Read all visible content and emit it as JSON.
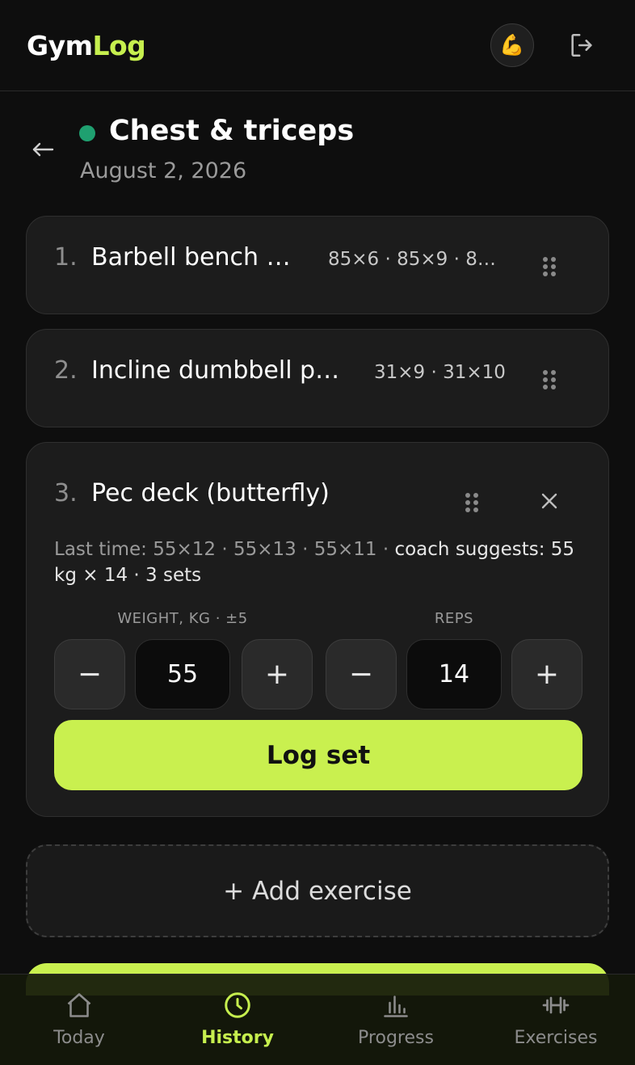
{
  "app": {
    "logo_part1": "Gym",
    "logo_part2": "Log",
    "avatar_emoji": "💪"
  },
  "workout": {
    "title": "Chest & triceps",
    "date": "August 2, 2026",
    "status_color": "#1fa070"
  },
  "exercises": [
    {
      "number": "1.",
      "name": "Barbell bench …",
      "sets": "85×6 · 85×9 · 8…"
    },
    {
      "number": "2.",
      "name": "Incline dumbbell p…",
      "sets": "31×9 · 31×10"
    },
    {
      "number": "3.",
      "name": "Pec deck (butterfly)",
      "last_time": "Last time: 55×12 · 55×13 · 55×11 · ",
      "suggestion": "coach suggests: 55 kg × 14 · 3 sets",
      "weight_label": "WEIGHT, KG · ±5",
      "reps_label": "REPS",
      "weight_value": "55",
      "reps_value": "14",
      "minus": "−",
      "plus": "+",
      "log_button": "Log set"
    }
  ],
  "add_exercise": "+ Add exercise",
  "nav": [
    {
      "label": "Today",
      "icon": "home-icon",
      "active": false
    },
    {
      "label": "History",
      "icon": "clock-icon",
      "active": true
    },
    {
      "label": "Progress",
      "icon": "bar-chart-icon",
      "active": false
    },
    {
      "label": "Exercises",
      "icon": "dumbbell-icon",
      "active": false
    }
  ],
  "colors": {
    "accent": "#c9f04f",
    "background": "#0e0e0e",
    "card": "#1c1c1c"
  }
}
